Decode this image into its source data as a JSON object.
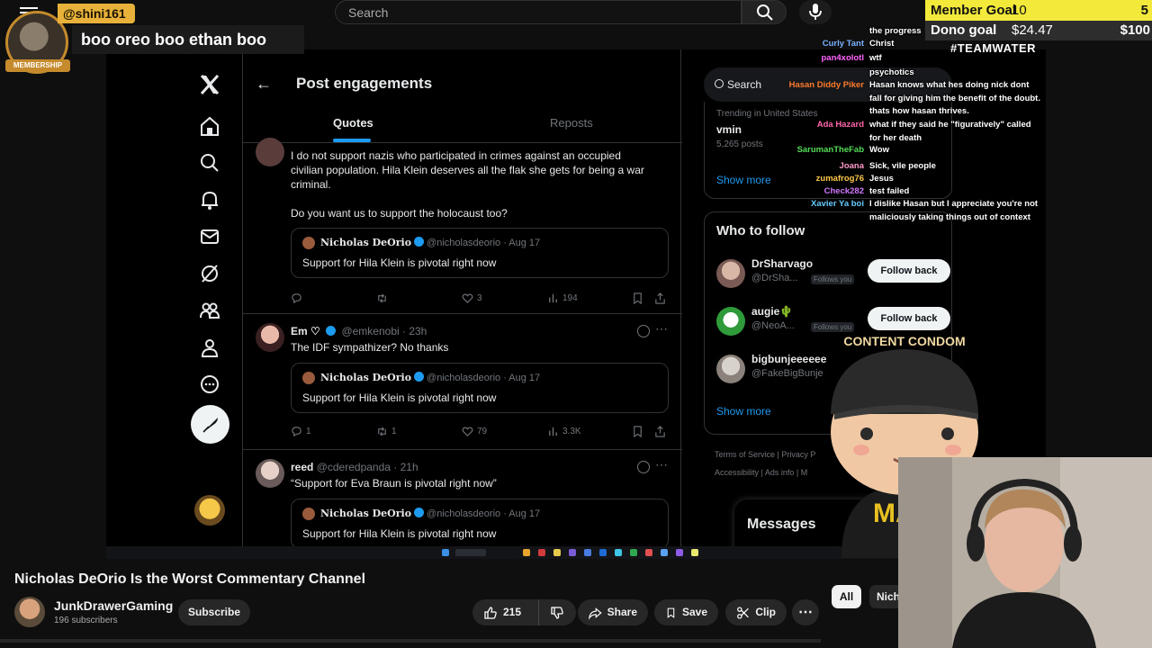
{
  "yt": {
    "search_placeholder": "Search",
    "video_title": "Nicholas DeOrio Is the Worst Commentary Channel",
    "channel_name": "JunkDrawerGaming",
    "subscribers": "196 subscribers",
    "subscribe_label": "Subscribe",
    "likes": "215",
    "share_label": "Share",
    "save_label": "Save",
    "clip_label": "Clip",
    "chips": [
      "All",
      "Nich"
    ]
  },
  "overlay": {
    "chat_username": "@shini161",
    "chat_message": "boo oreo boo ethan boo",
    "membership_label": "MEMBERSHIP",
    "goals": [
      {
        "label": "Member Goal",
        "current": "10",
        "target": "5"
      },
      {
        "label": "Dono goal",
        "current": "$24.47",
        "target": "$100"
      }
    ],
    "team_tag": "#TEAMWATER",
    "mascot_cap_text": "CONTENT CONDOM",
    "mascot_shirt_text": "MAG",
    "stream_chat": [
      {
        "name": "",
        "msg": "the progress",
        "color": "#9ad1ff"
      },
      {
        "name": "Curly Tant",
        "msg": "Christ",
        "color": "#7ab0ff"
      },
      {
        "name": "pan4xolotl",
        "msg": "wtf",
        "color": "#ff66ff"
      },
      {
        "name": "",
        "msg": "psychotics",
        "color": "#ff4466"
      },
      {
        "name": "Hasan Diddy Piker",
        "msg": "Hasan knows what hes doing nick dont fall for giving him the benefit of the doubt. thats how hasan thrives.",
        "color": "#ff7a2a"
      },
      {
        "name": "Ada Hazard",
        "msg": "what if they said he \"figuratively\" called for her death",
        "color": "#ff66aa"
      },
      {
        "name": "SarumanTheFab",
        "msg": "Wow",
        "color": "#55dd55"
      },
      {
        "name": "Joana",
        "msg": "Sick, vile people",
        "color": "#ff9acb"
      },
      {
        "name": "zumafrog76",
        "msg": "Jesus",
        "color": "#ffc84a"
      },
      {
        "name": "Check282",
        "msg": "test failed",
        "color": "#d077ff"
      },
      {
        "name": "Xavier Ya boi",
        "msg": "I dislike Hasan but I appreciate you're not maliciously taking things out of context",
        "color": "#66ccff"
      }
    ]
  },
  "x": {
    "page_title": "Post engagements",
    "tabs": [
      "Quotes",
      "Reposts"
    ],
    "posts": [
      {
        "name": "",
        "handle": "",
        "text_lines": [
          "I do not support nazis who participated in crimes against an occupied",
          "civilian population. Hila Klein deserves all the flak she gets for being a war",
          "criminal.",
          "",
          "Do you want us to support the holocaust too?"
        ],
        "quote_name": "Nicholas DeOrio",
        "quote_meta": "@nicholasdeorio · Aug 17",
        "quote_text": "Support for Hila Klein is pivotal right now",
        "replies": "",
        "reposts": "",
        "likes": "3",
        "views": "194"
      },
      {
        "name": "Em ♡",
        "handle": "@emkenobi · 23h",
        "text_lines": [
          "The IDF sympathizer? No thanks"
        ],
        "quote_name": "Nicholas DeOrio",
        "quote_meta": "@nicholasdeorio · Aug 17",
        "quote_text": "Support for Hila Klein is pivotal right now",
        "replies": "1",
        "reposts": "1",
        "likes": "79",
        "views": "3.3K"
      },
      {
        "name": "reed",
        "handle": "@cderedpanda · 21h",
        "text_lines": [
          "“Support for Eva Braun is pivotal right now”"
        ],
        "quote_name": "Nicholas DeOrio",
        "quote_meta": "@nicholasdeorio · Aug 17",
        "quote_text": "Support for Hila Klein is pivotal right now"
      }
    ],
    "sidebar": {
      "search_label": "Search",
      "trend_category": "Trending in United States",
      "trend_name": "vmin",
      "trend_count": "5,265 posts",
      "show_more": "Show more",
      "who_to_follow": "Who to follow",
      "follows_you": "Follows you",
      "follow_back": "Follow back",
      "suggestions": [
        {
          "name": "DrSharvago",
          "handle": "@DrSha...",
          "follows_you": true,
          "button": true
        },
        {
          "name": "augie🌵",
          "handle": "@NeoA...",
          "follows_you": true,
          "button": true
        },
        {
          "name": "bigbunjeeeeee",
          "handle": "@FakeBigBunje",
          "follows_you": false,
          "button": false
        }
      ],
      "footer_line1": "Terms of Service  |  Privacy P",
      "footer_line2": "Accessibility  |  Ads info  |  M",
      "messages": "Messages"
    }
  },
  "colors": {
    "x_blue": "#1d9bf0",
    "goal_yellow": "#f2e93a",
    "member_gold": "#e8b23a"
  }
}
